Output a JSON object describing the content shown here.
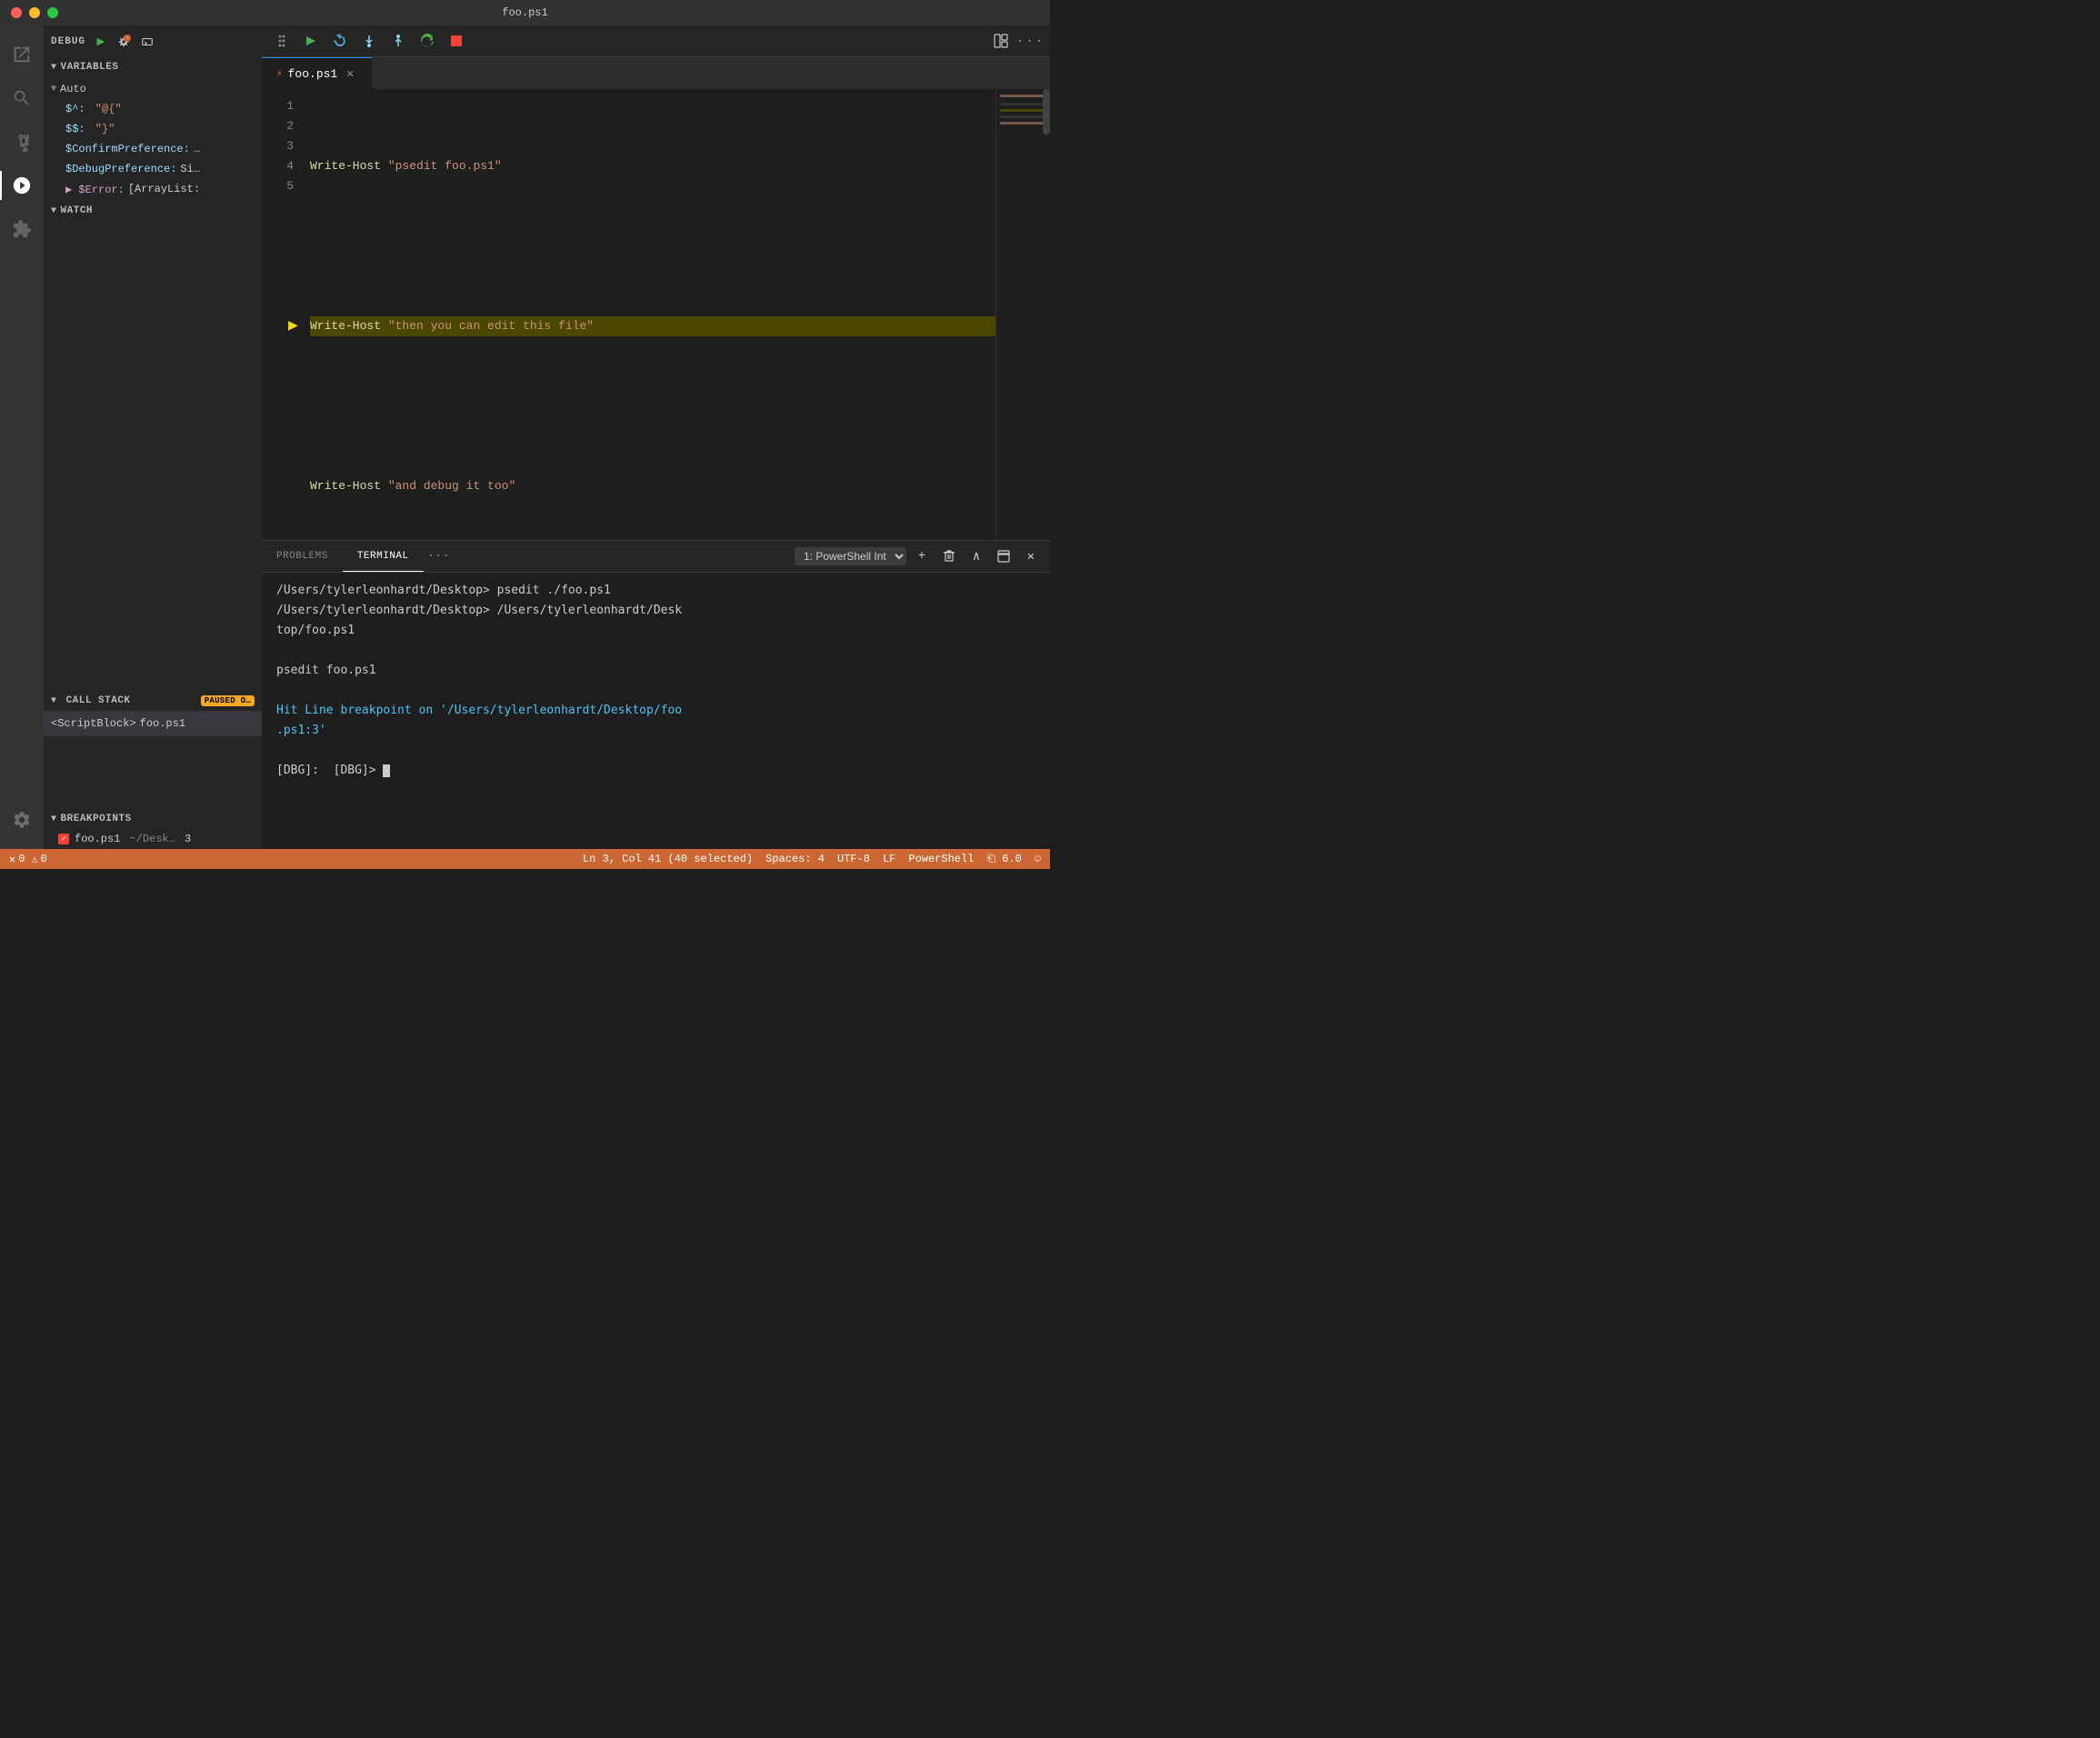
{
  "titleBar": {
    "title": "foo.ps1"
  },
  "activityBar": {
    "icons": [
      {
        "name": "explorer-icon",
        "symbol": "⬡",
        "active": false
      },
      {
        "name": "search-icon",
        "symbol": "🔍",
        "active": false
      },
      {
        "name": "source-control-icon",
        "symbol": "⑂",
        "active": false
      },
      {
        "name": "debug-icon",
        "symbol": "◎",
        "active": true
      },
      {
        "name": "extensions-icon",
        "symbol": "⊞",
        "active": false
      },
      {
        "name": "settings-icon",
        "symbol": "⚙",
        "active": false
      }
    ]
  },
  "sidebar": {
    "debug": {
      "title": "DEBUG",
      "btnLabel": "▶",
      "gearLabel": "⚙",
      "terminalLabel": "▭"
    },
    "variables": {
      "header": "VARIABLES",
      "autoSection": {
        "label": "Auto",
        "items": [
          {
            "name": "$^:",
            "value": "\"@{\""
          },
          {
            "name": "$$:",
            "value": "\"}\""
          },
          {
            "name": "$ConfirmPreference:",
            "value": "…"
          },
          {
            "name": "$DebugPreference:",
            "value": "Si…"
          },
          {
            "name": "$Error:",
            "value": "[ArrayList:"
          }
        ]
      }
    },
    "watch": {
      "header": "WATCH"
    },
    "callStack": {
      "header": "CALL STACK",
      "pausedBadge": "PAUSED O…",
      "items": [
        {
          "block": "<ScriptBlock>",
          "file": "foo.ps1"
        }
      ]
    },
    "breakpoints": {
      "header": "BREAKPOINTS",
      "items": [
        {
          "file": "foo.ps1",
          "path": "~/Desk…",
          "line": "3"
        }
      ]
    }
  },
  "toolbar": {
    "dotGrid": "⠿",
    "play": "▶",
    "restart": "↺",
    "stepOver": "↓",
    "stepInto": "↑",
    "refresh": "↺",
    "stop": "■",
    "layoutBtn": "⊟",
    "moreBtn": "…"
  },
  "tabs": [
    {
      "icon": "⚡",
      "label": "foo.ps1",
      "active": true,
      "close": "✕"
    }
  ],
  "editor": {
    "lines": [
      {
        "num": 1,
        "content": "Write-Host \"psedit foo.ps1\"",
        "highlighted": false,
        "hasBreakpoint": false,
        "hasArrow": false
      },
      {
        "num": 2,
        "content": "",
        "highlighted": false,
        "hasBreakpoint": false,
        "hasArrow": false
      },
      {
        "num": 3,
        "content": "Write-Host \"then you can edit this file\"",
        "highlighted": true,
        "hasBreakpoint": true,
        "hasArrow": true
      },
      {
        "num": 4,
        "content": "",
        "highlighted": false,
        "hasBreakpoint": false,
        "hasArrow": false
      },
      {
        "num": 5,
        "content": "Write-Host \"and debug it too\"",
        "highlighted": false,
        "hasBreakpoint": false,
        "hasArrow": false
      }
    ]
  },
  "panel": {
    "tabs": [
      {
        "label": "PROBLEMS",
        "active": false
      },
      {
        "label": "TERMINAL",
        "active": true
      }
    ],
    "moreBtn": "···",
    "terminalSelect": "1: PowerShell Int",
    "controls": {
      "add": "+",
      "delete": "🗑",
      "up": "∧",
      "split": "⊟",
      "close": "✕"
    },
    "terminal": {
      "lines": [
        {
          "text": "/Users/tylerleonhardt/Desktop> psedit ./foo.ps1",
          "type": "prompt"
        },
        {
          "text": "/Users/tylerleonhardt/Desktop> /Users/tylerleonhardt/Desk",
          "type": "prompt"
        },
        {
          "text": "top/foo.ps1",
          "type": "prompt"
        },
        {
          "text": "",
          "type": "prompt"
        },
        {
          "text": "psedit foo.ps1",
          "type": "prompt"
        },
        {
          "text": "",
          "type": "prompt"
        },
        {
          "text": "Hit Line breakpoint on '/Users/tylerleonhardt/Desktop/foo.ps1:3'",
          "type": "blue"
        },
        {
          "text": "",
          "type": "prompt"
        },
        {
          "text": "[DBG]:  [DBG]>",
          "type": "prompt",
          "hasCursor": true
        }
      ]
    }
  },
  "statusBar": {
    "errors": "0",
    "warnings": "0",
    "position": "Ln 3, Col 41 (40 selected)",
    "spaces": "Spaces: 4",
    "encoding": "UTF-8",
    "lineEnding": "LF",
    "language": "PowerShell",
    "version": "⎗ 6.0",
    "smiley": "☺"
  }
}
